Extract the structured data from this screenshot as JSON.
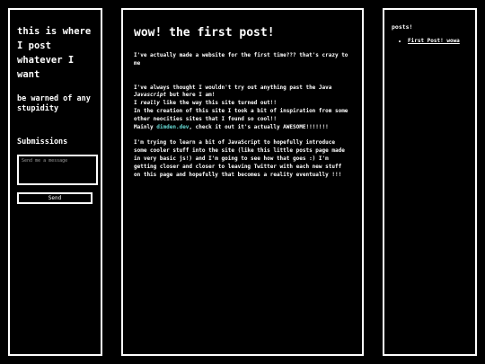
{
  "sidebar_left": {
    "site_title": "this is where I post whatever I want",
    "warning": "be warned of any stupidity",
    "submissions_heading": "Submissions",
    "message_placeholder": "Send me a message",
    "send_label": "Send"
  },
  "post": {
    "title": "wow! the first post!",
    "intro": "I've actually made a website for the first time??? that's crazy to me",
    "p2_line1_a": "I've always thought I wouldn't try out anything past the Java",
    "p2_line1_italic": "Javascript",
    "p2_line1_b": " but here I am!",
    "p2_line2_a": "I ",
    "p2_line2_italic": "really",
    "p2_line2_b": " like the way this site turned out!!",
    "p2_line3": "In the creation of this site I took a bit of inspiration from some other neocities sites that I found so cool!!",
    "p2_line4_a": "Mainly ",
    "p2_line4_link": "dimden.dev",
    "p2_line4_b": ", check it out it's actually AWESOME!!!!!!!",
    "p3": "I'm trying to learn a bit of JavaScript to hopefully introduce some cooler stuff into the site (like this little posts page made in very basic js!) and I'm going to see how that goes :) I'm getting closer and closer to leaving Twitter with each new stuff on this page and hopefully that becomes a reality eventually !!!",
    "link_color": "#66d9d4"
  },
  "sidebar_right": {
    "posts_heading": "posts!",
    "posts": [
      "First Post! wowa"
    ]
  }
}
